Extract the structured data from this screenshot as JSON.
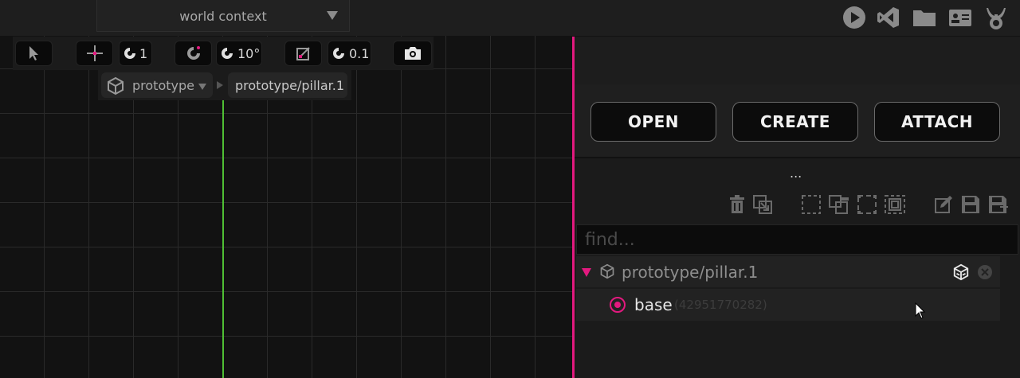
{
  "header": {
    "context_select": {
      "value": "world context",
      "icon": "chevron-down-icon"
    },
    "top_icons": [
      "play-icon",
      "vscode-icon",
      "folder-icon",
      "id-card-icon",
      "horn-logo-icon"
    ]
  },
  "toolbar": {
    "select_tool": "select-arrow-icon",
    "translate_tool": "move-icon",
    "translate_snap": "1",
    "rotate_tool": "rotate-icon",
    "rotate_snap": "10°",
    "scale_tool": "scale-icon",
    "scale_snap": "0.1",
    "camera_tool": "camera-icon"
  },
  "breadcrumb": {
    "prototype_select": "prototype",
    "path": "prototype/pillar.1"
  },
  "panel": {
    "buttons": {
      "open": "OPEN",
      "create": "CREATE",
      "attach": "ATTACH"
    },
    "ellipsis": "...",
    "tools": [
      "trash-icon",
      "duplicate-icon",
      "select-box-icon",
      "group-icon",
      "select-dashed-icon",
      "ungroup-icon",
      "edit-icon",
      "save-icon",
      "save-as-icon"
    ],
    "find_placeholder": "find...",
    "tree": {
      "root_label": "prototype/pillar.1",
      "child_label": "base",
      "child_id": "(42951770282)"
    }
  },
  "colors": {
    "accent": "#e3197f",
    "axis": "#4fbf34",
    "background": "#121212"
  }
}
